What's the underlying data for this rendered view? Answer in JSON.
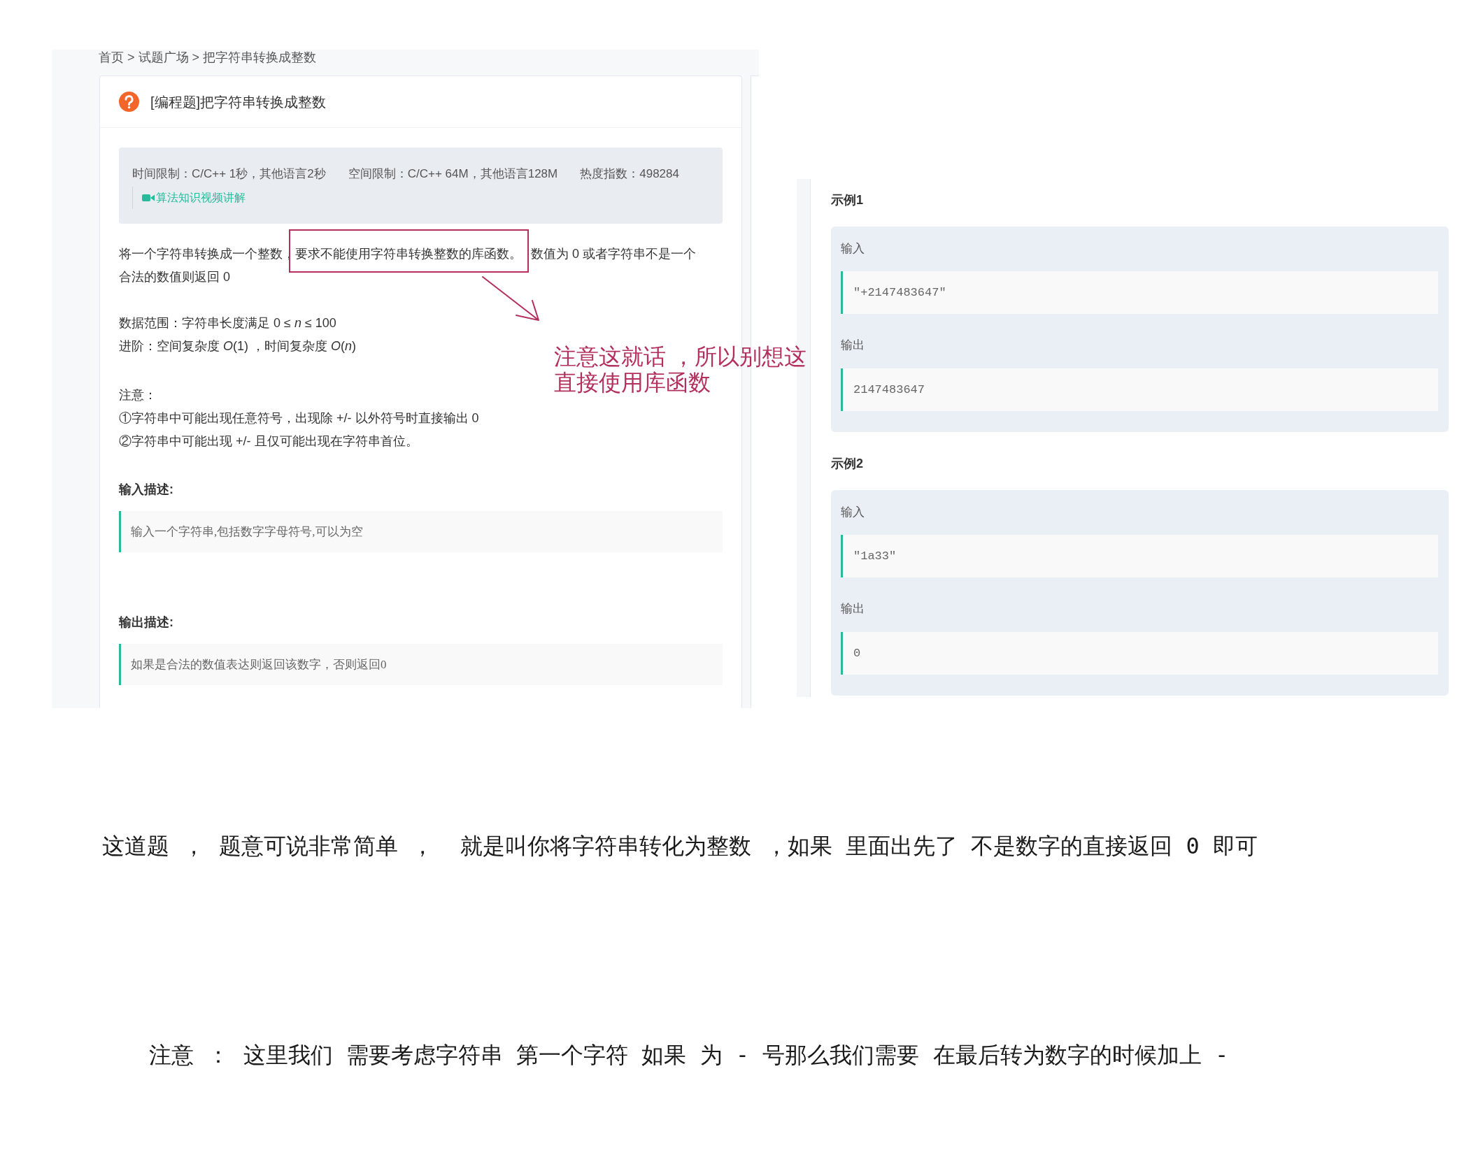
{
  "left_screenshot": {
    "breadcrumb": "首页 > 试题广场 > 把字符串转换成整数",
    "problem_title": "[编程题]把字符串转换成整数",
    "limits": [
      "时间限制：C/C++ 1秒，其他语言2秒",
      "空间限制：C/C++ 64M，其他语言128M",
      "热度指数：498284"
    ],
    "video_link": "算法知识视频讲解",
    "statement": [
      {
        "text": "将一个字符串转换成一个整数，",
        "highlighted": false
      },
      {
        "text": "要求不能使用字符串转换整数的库函数。",
        "highlighted": true
      },
      {
        "text": " 数值为 0 或者字符串不是一个合法的数值则返回 0",
        "highlighted": false
      }
    ],
    "range": "数据范围：字符串长度满足 0 ≤ *n* ≤ 100",
    "advanced": "进阶：空间复杂度 *O*(1) ，时间复杂度 *O*(*n*)",
    "notes_title": "注意：",
    "notes": [
      "①字符串中可能出现任意符号，出现除 +/- 以外符号时直接输出 0",
      "②字符串中可能出现 +/- 且仅可能出现在字符串首位。"
    ],
    "descriptions": [
      {
        "title": "输入描述:",
        "text": "输入一个字符串,包括数字字母符号,可以为空"
      },
      {
        "title": "输出描述:",
        "text": "如果是合法的数值表达则返回该数字，否则返回0"
      }
    ]
  },
  "annotation": {
    "note": "注意这就话 ，所以别想这直接使用库函数"
  },
  "right_screenshot": {
    "examples": [
      {
        "title": "示例1",
        "input_label": "输入",
        "input": "\"+2147483647\"",
        "output_label": "输出",
        "output": "2147483647"
      },
      {
        "title": "示例2",
        "input_label": "输入",
        "input": "\"1a33\"",
        "output_label": "输出",
        "output": "0"
      }
    ]
  },
  "comments": [
    "这道题 ， 题意可说非常简单 ，  就是叫你将字符串转化为整数 ，如果 里面出先了 不是数字的直接返回 0 即可",
    "注意 ： 这里我们 需要考虑字符串 第一个字符 如果 为 - 号那么我们需要 在最后转为数字的时候加上 -"
  ]
}
